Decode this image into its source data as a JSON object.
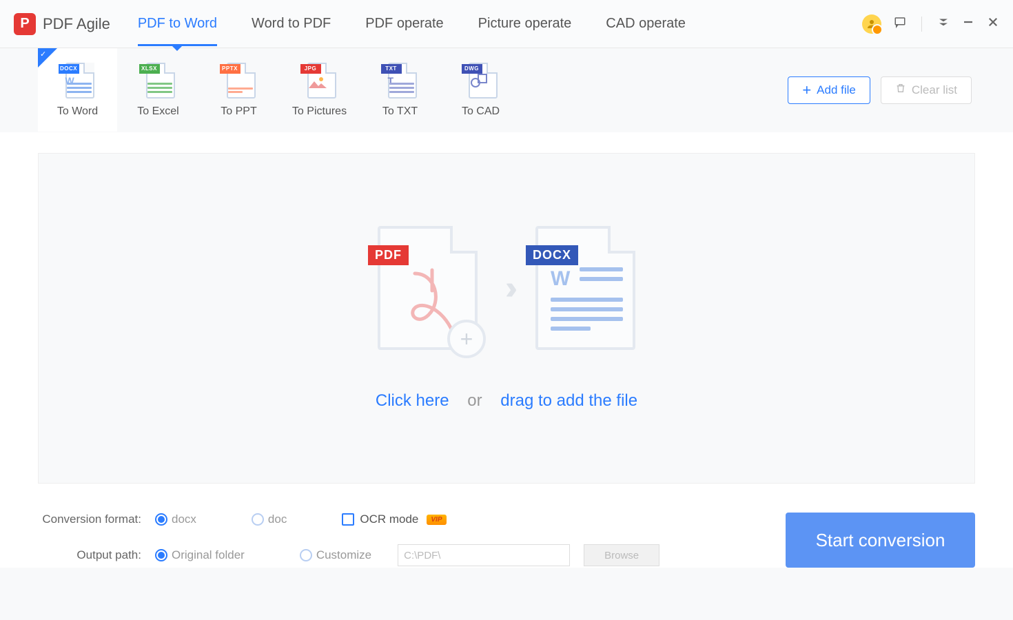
{
  "app": {
    "title": "PDF Agile"
  },
  "main_tabs": [
    "PDF to Word",
    "Word to PDF",
    "PDF operate",
    "Picture operate",
    "CAD operate"
  ],
  "conv_tabs": [
    {
      "label": "To Word",
      "tag": "DOCX",
      "tagClass": "tag-docx"
    },
    {
      "label": "To Excel",
      "tag": "XLSX",
      "tagClass": "tag-xlsx"
    },
    {
      "label": "To PPT",
      "tag": "PPTX",
      "tagClass": "tag-pptx"
    },
    {
      "label": "To Pictures",
      "tag": "JPG",
      "tagClass": "tag-jpg"
    },
    {
      "label": "To TXT",
      "tag": "TXT",
      "tagClass": "tag-txt"
    },
    {
      "label": "To CAD",
      "tag": "DWG",
      "tagClass": "tag-dwg"
    }
  ],
  "buttons": {
    "add_file": "Add file",
    "clear_list": "Clear list",
    "start": "Start conversion",
    "browse": "Browse"
  },
  "dropzone": {
    "click_here": "Click here",
    "or": "or",
    "drag": "drag to add the file",
    "badge_pdf": "PDF",
    "badge_docx": "DOCX"
  },
  "options": {
    "format_label": "Conversion format:",
    "format_docx": "docx",
    "format_doc": "doc",
    "ocr_label": "OCR mode",
    "path_label": "Output path:",
    "path_original": "Original folder",
    "path_custom": "Customize",
    "path_value": "C:\\PDF\\"
  }
}
